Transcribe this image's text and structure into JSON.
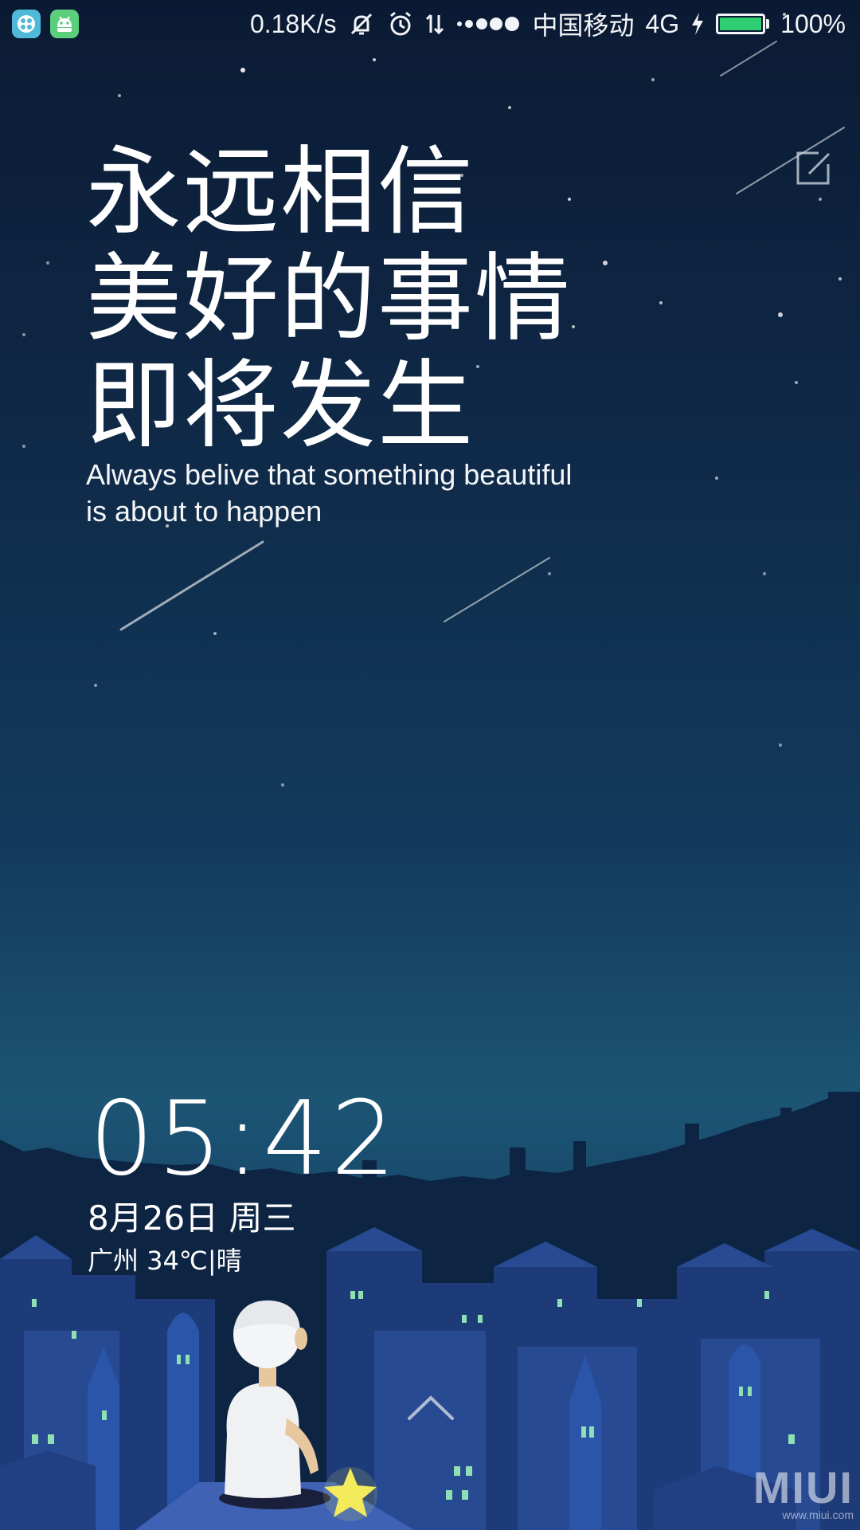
{
  "status_bar": {
    "net_speed": "0.18K/s",
    "carrier": "中国移动",
    "network": "4G",
    "battery_percent": "100%",
    "battery_level": 1.0,
    "battery_color": "#2ecf73",
    "left_icons": [
      "game-app-icon",
      "android-app-icon"
    ],
    "right_icons": [
      "mute-bell-icon",
      "alarm-icon",
      "data-transfer-icon",
      "signal-dots-icon",
      "charging-bolt-icon",
      "battery-icon"
    ]
  },
  "quote": {
    "cn_lines": [
      "永远相信",
      "美好的事情",
      "即将发生"
    ],
    "en_line1": "Always belive that something beautiful",
    "en_line2": "is about to happen"
  },
  "edit_icon": "edit-icon",
  "clock": {
    "time": "05:42",
    "date": "8月26日 周三",
    "weather": "广州 34℃|晴"
  },
  "unlock_hint_icon": "chevron-up-icon",
  "watermark": {
    "logo": "MIUI",
    "site": "www.miui.com"
  }
}
